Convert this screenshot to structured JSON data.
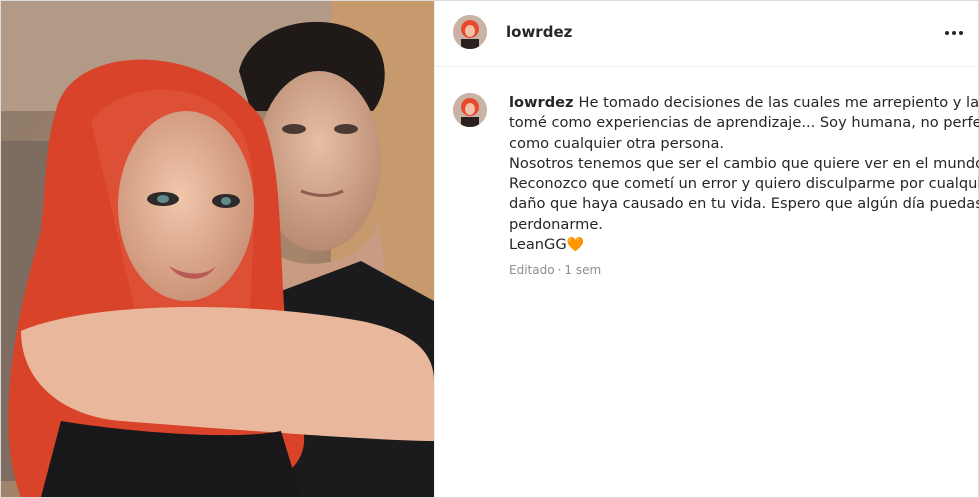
{
  "post": {
    "username": "lowrdez",
    "photo_alt": "",
    "colors": {
      "heart": "#f07a2a",
      "text": "#262626",
      "muted": "#8e8e8e"
    }
  },
  "header": {
    "username": "lowrdez",
    "more_icon": "more-horizontal-icon"
  },
  "comment": {
    "username": "lowrdez",
    "lines": [
      "He tomado decisiones de las cuales me arrepiento y las",
      "tomé como experiencias de aprendizaje... Soy humana, no perfecta,",
      "como cualquier otra persona.",
      "Nosotros tenemos que ser el cambio que quiere ver en el mundo",
      "Reconozco que cometí un error y quiero disculparme por cualquier",
      "daño que haya causado en tu vida. Espero que algún día puedas",
      "perdonarme.",
      "LeanGG"
    ],
    "heart": "🧡",
    "edited_label": "Editado",
    "separator": "·",
    "time": "1 sem"
  }
}
